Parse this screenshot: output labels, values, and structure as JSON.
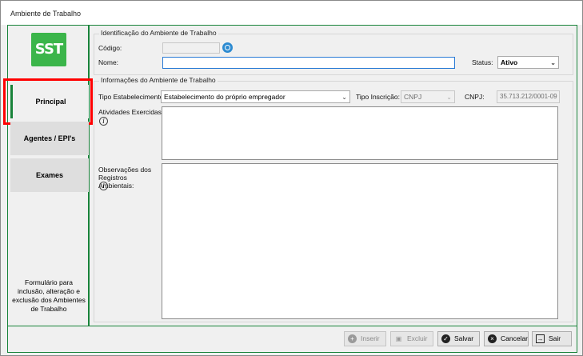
{
  "window": {
    "title": "Ambiente de Trabalho"
  },
  "sidebar": {
    "logo_text": "SST",
    "items": [
      {
        "label": "Principal"
      },
      {
        "label": "Agentes / EPI's"
      },
      {
        "label": "Exames"
      }
    ],
    "description": "Formulário para inclusão, alteração e exclusão dos Ambientes de Trabalho"
  },
  "identification": {
    "group_title": "Identificação do Ambiente de Trabalho",
    "code_label": "Código:",
    "code_value": "",
    "name_label": "Nome:",
    "name_value": "",
    "status_label": "Status:",
    "status_value": "Ativo"
  },
  "info": {
    "group_title": "Informações do Ambiente de Trabalho",
    "establishment_label": "Tipo Estabelecimento:",
    "establishment_value": "Estabelecimento do próprio empregador",
    "inscription_label": "Tipo Inscrição:",
    "inscription_value": "CNPJ",
    "cnpj_label": "CNPJ:",
    "cnpj_value": "35.713.212/0001-09",
    "activities_label": "Atividades Exercidas:",
    "observations_label": "Observações dos Registros Ambientais:"
  },
  "footer": {
    "insert_label": "Inserir",
    "delete_label": "Excluir",
    "save_label": "Salvar",
    "cancel_label": "Cancelar",
    "exit_label": "Sair"
  },
  "colors": {
    "accent": "#19833a",
    "highlight": "#ff0000",
    "logo": "#3bb54a"
  }
}
